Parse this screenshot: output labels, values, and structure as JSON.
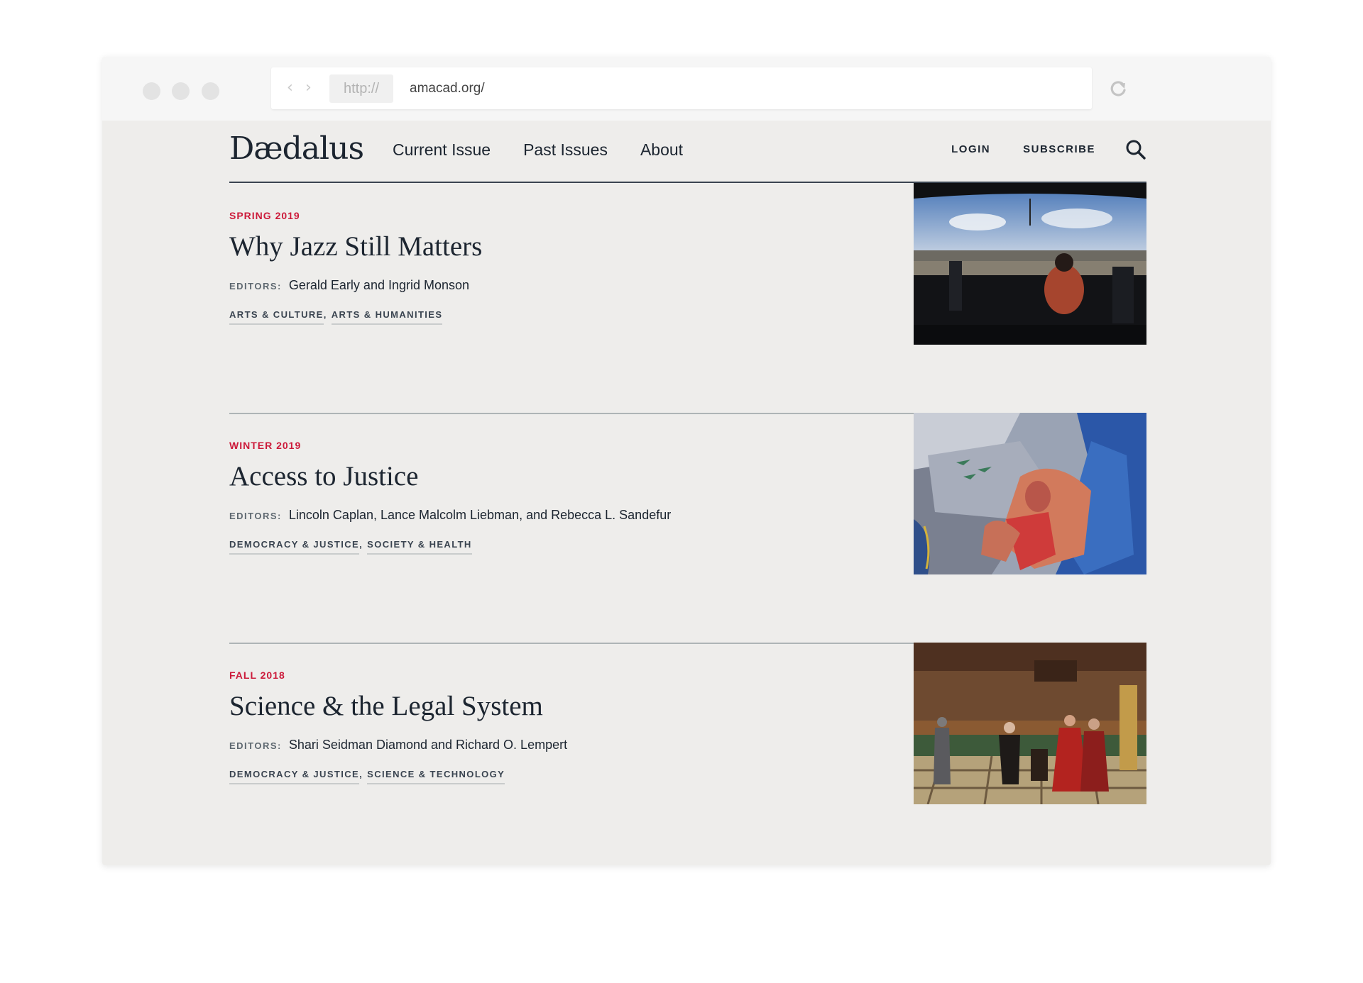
{
  "browser": {
    "protocol": "http://",
    "url": "amacad.org/"
  },
  "site": {
    "logo": "Dædalus",
    "nav": [
      "Current Issue",
      "Past Issues",
      "About"
    ],
    "login_label": "LOGIN",
    "subscribe_label": "SUBSCRIBE",
    "accent_color": "#cc1a3a"
  },
  "issues": [
    {
      "season": "SPRING 2019",
      "title": "Why Jazz Still Matters",
      "editors_label": "EDITORS:",
      "editors": "Gerald Early and Ingrid Monson",
      "tags": [
        "ARTS & CULTURE",
        "ARTS & HUMANITIES"
      ],
      "image": "jazz-festival-stage-photo"
    },
    {
      "season": "WINTER 2019",
      "title": "Access to Justice",
      "editors_label": "EDITORS:",
      "editors": "Lincoln Caplan, Lance Malcolm Liebman, and Rebecca L. Sandefur",
      "tags": [
        "DEMOCRACY & JUSTICE",
        "SOCIETY & HEALTH"
      ],
      "image": "abstract-figurative-painting"
    },
    {
      "season": "FALL 2018",
      "title": "Science & the Legal System",
      "editors_label": "EDITORS:",
      "editors": "Shari Seidman Diamond and Richard O. Lempert",
      "tags": [
        "DEMOCRACY & JUSTICE",
        "SCIENCE & TECHNOLOGY"
      ],
      "image": "historical-tribunal-painting"
    }
  ]
}
